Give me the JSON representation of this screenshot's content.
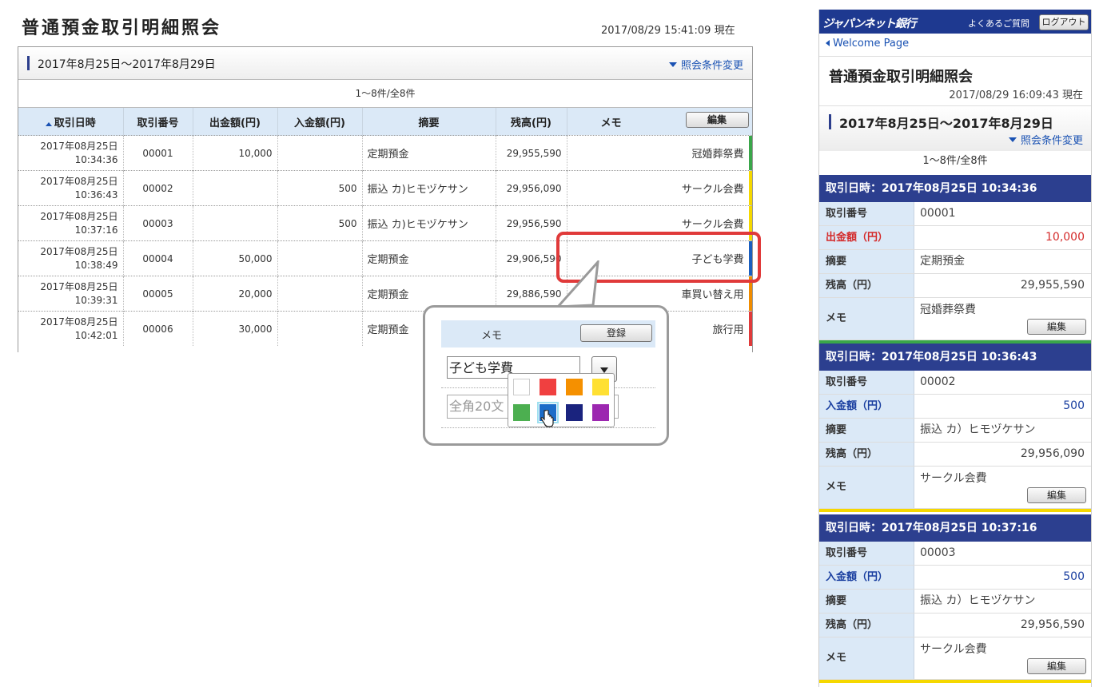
{
  "desktop": {
    "title": "普通預金取引明細照会",
    "timestamp": "2017/08/29 15:41:09 現在",
    "range": "2017年8月25日～2017年8月29日",
    "change_link": "照会条件変更",
    "count": "1～8件/全8件",
    "headers": [
      "取引日時",
      "取引番号",
      "出金額(円)",
      "入金額(円)",
      "摘要",
      "残高(円)",
      "メモ"
    ],
    "edit_label": "編集",
    "rows": [
      {
        "date": "2017年08月25日",
        "time": "10:34:36",
        "no": "00001",
        "out": "10,000",
        "in": "",
        "summary": "定期預金",
        "balance": "29,955,590",
        "memo": "冠婚葬祭費",
        "color": "#3aa64a"
      },
      {
        "date": "2017年08月25日",
        "time": "10:36:43",
        "no": "00002",
        "out": "",
        "in": "500",
        "summary": "振込 カ)ヒモヅケサン",
        "balance": "29,956,090",
        "memo": "サークル会費",
        "color": "#f5d800"
      },
      {
        "date": "2017年08月25日",
        "time": "10:37:16",
        "no": "00003",
        "out": "",
        "in": "500",
        "summary": "振込 カ)ヒモヅケサン",
        "balance": "29,956,590",
        "memo": "サークル会費",
        "color": "#f5d800"
      },
      {
        "date": "2017年08月25日",
        "time": "10:38:49",
        "no": "00004",
        "out": "50,000",
        "in": "",
        "summary": "定期預金",
        "balance": "29,906,590",
        "memo": "子ども学費",
        "color": "#1b5fbf"
      },
      {
        "date": "2017年08月25日",
        "time": "10:39:31",
        "no": "00005",
        "out": "20,000",
        "in": "",
        "summary": "定期預金",
        "balance": "29,886,590",
        "memo": "車買い替え用",
        "color": "#f08c00"
      },
      {
        "date": "2017年08月25日",
        "time": "10:42:01",
        "no": "00006",
        "out": "30,000",
        "in": "",
        "summary": "定期預金",
        "balance": "",
        "memo": "旅行用",
        "color": "#e03a3a"
      }
    ],
    "memo_popup": {
      "label": "メモ",
      "register": "登録",
      "memo_value": "子ども学費",
      "placeholder": "全角20文",
      "colors": [
        "#ffffff",
        "#f04040",
        "#f59000",
        "#ffe033",
        "#4caf50",
        "#1b6cc8",
        "#1a237e",
        "#9c27b0"
      ]
    }
  },
  "mobile": {
    "logo": "ジャパンネット銀行",
    "faq": "よくあるご質問",
    "logout": "ログアウト",
    "welcome": "Welcome Page",
    "title": "普通預金取引明細照会",
    "timestamp": "2017/08/29 16:09:43 現在",
    "range": "2017年8月25日～2017年8月29日",
    "change_link": "照会条件変更",
    "count": "1～8件/全8件",
    "edit_label": "編集",
    "cards": [
      {
        "header": "取引日時：2017年08月25日 10:34:36",
        "k_no": "取引番号",
        "no": "00001",
        "amount_label": "出金額（円）",
        "amount": "10,000",
        "k_summary": "摘要",
        "summary": "定期預金",
        "k_balance": "残高（円）",
        "balance": "29,955,590",
        "k_memo": "メモ",
        "memo": "冠婚葬祭費",
        "type": "out",
        "color": "#3aa64a"
      },
      {
        "header": "取引日時：2017年08月25日 10:36:43",
        "k_no": "取引番号",
        "no": "00002",
        "amount_label": "入金額（円）",
        "amount": "500",
        "k_summary": "摘要",
        "summary": "振込 カ）ヒモヅケサン",
        "k_balance": "残高（円）",
        "balance": "29,956,090",
        "k_memo": "メモ",
        "memo": "サークル会費",
        "type": "in",
        "color": "#f5d800"
      },
      {
        "header": "取引日時：2017年08月25日 10:37:16",
        "k_no": "取引番号",
        "no": "00003",
        "amount_label": "入金額（円）",
        "amount": "500",
        "k_summary": "摘要",
        "summary": "振込 カ）ヒモヅケサン",
        "k_balance": "残高（円）",
        "balance": "29,956,590",
        "k_memo": "メモ",
        "memo": "サークル会費",
        "type": "in",
        "color": "#f5d800"
      }
    ]
  }
}
